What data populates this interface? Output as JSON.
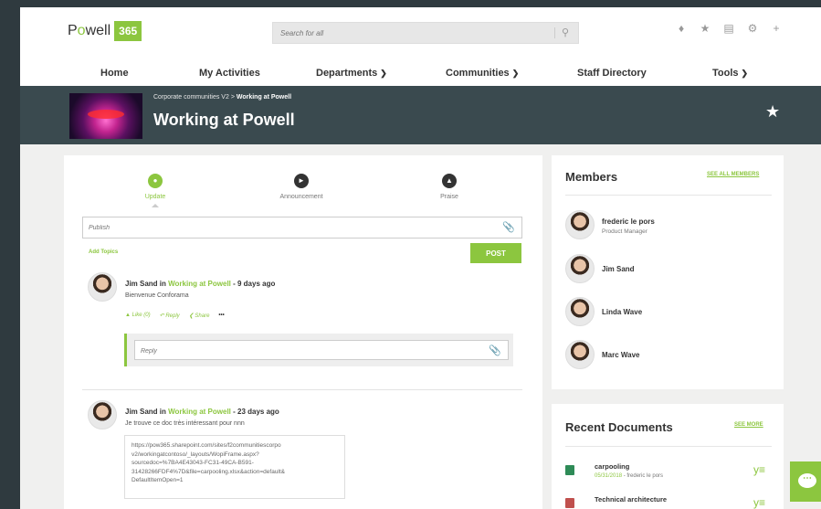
{
  "brand": {
    "name_pre": "P",
    "name_o": "o",
    "name_post": "well",
    "badge": "365"
  },
  "search": {
    "placeholder": "Search for all"
  },
  "nav": {
    "home": "Home",
    "my_activities": "My Activities",
    "departments": "Departments",
    "communities": "Communities",
    "staff_directory": "Staff Directory",
    "tools": "Tools"
  },
  "banner": {
    "crumb_parent": "Corporate communities V2",
    "crumb_sep": " > ",
    "crumb_current": "Working at Powell",
    "title": "Working at Powell"
  },
  "composer": {
    "types": [
      {
        "label": "Update"
      },
      {
        "label": "Announcement"
      },
      {
        "label": "Praise"
      }
    ],
    "publish_placeholder": "Publish",
    "add_topics": "Add Topics",
    "post_label": "POST"
  },
  "posts": [
    {
      "author": "Jim Sand",
      "in": " in ",
      "community": "Working at Powell",
      "age": " - 9 days ago",
      "body": "Bienvenue Conforama",
      "like": "Like (0)",
      "reply": "Reply",
      "share": "Share",
      "more": "•••",
      "reply_placeholder": "Reply"
    },
    {
      "author": "Jim Sand",
      "in": " in ",
      "community": "Working at Powell",
      "age": " - 23 days ago",
      "body": "Je trouve ce doc très intéressant pour nnn",
      "link_lines": [
        "https://pow365.sharepoint.com/sites/f2communitiescorpo",
        "v2/workingatcontoso/_layouts/WopiFrame.aspx?",
        "sourcedoc=%7BA4E43043-FC31-49CA-B591-",
        "31428266FDF4%7D&file=carpooling.xlsx&action=default&",
        "DefaultItemOpen=1"
      ]
    }
  ],
  "members": {
    "title": "Members",
    "see_all": "SEE ALL MEMBERS",
    "items": [
      {
        "name": "frederic le pors",
        "role": "Product Manager"
      },
      {
        "name": "Jim Sand"
      },
      {
        "name": "Linda Wave"
      },
      {
        "name": "Marc Wave"
      }
    ]
  },
  "documents": {
    "title": "Recent Documents",
    "see_more": "SEE MORE",
    "items": [
      {
        "name": "carpooling",
        "date": "05/31/2018",
        "sep": " - ",
        "author": "frederic le pors",
        "icon": "excel-icon"
      },
      {
        "name": "Technical architecture",
        "icon": "powerpoint-icon"
      }
    ]
  },
  "colors": {
    "accent": "#8cc63f",
    "banner": "#3a4a4f",
    "frame": "#2f3a3f"
  }
}
